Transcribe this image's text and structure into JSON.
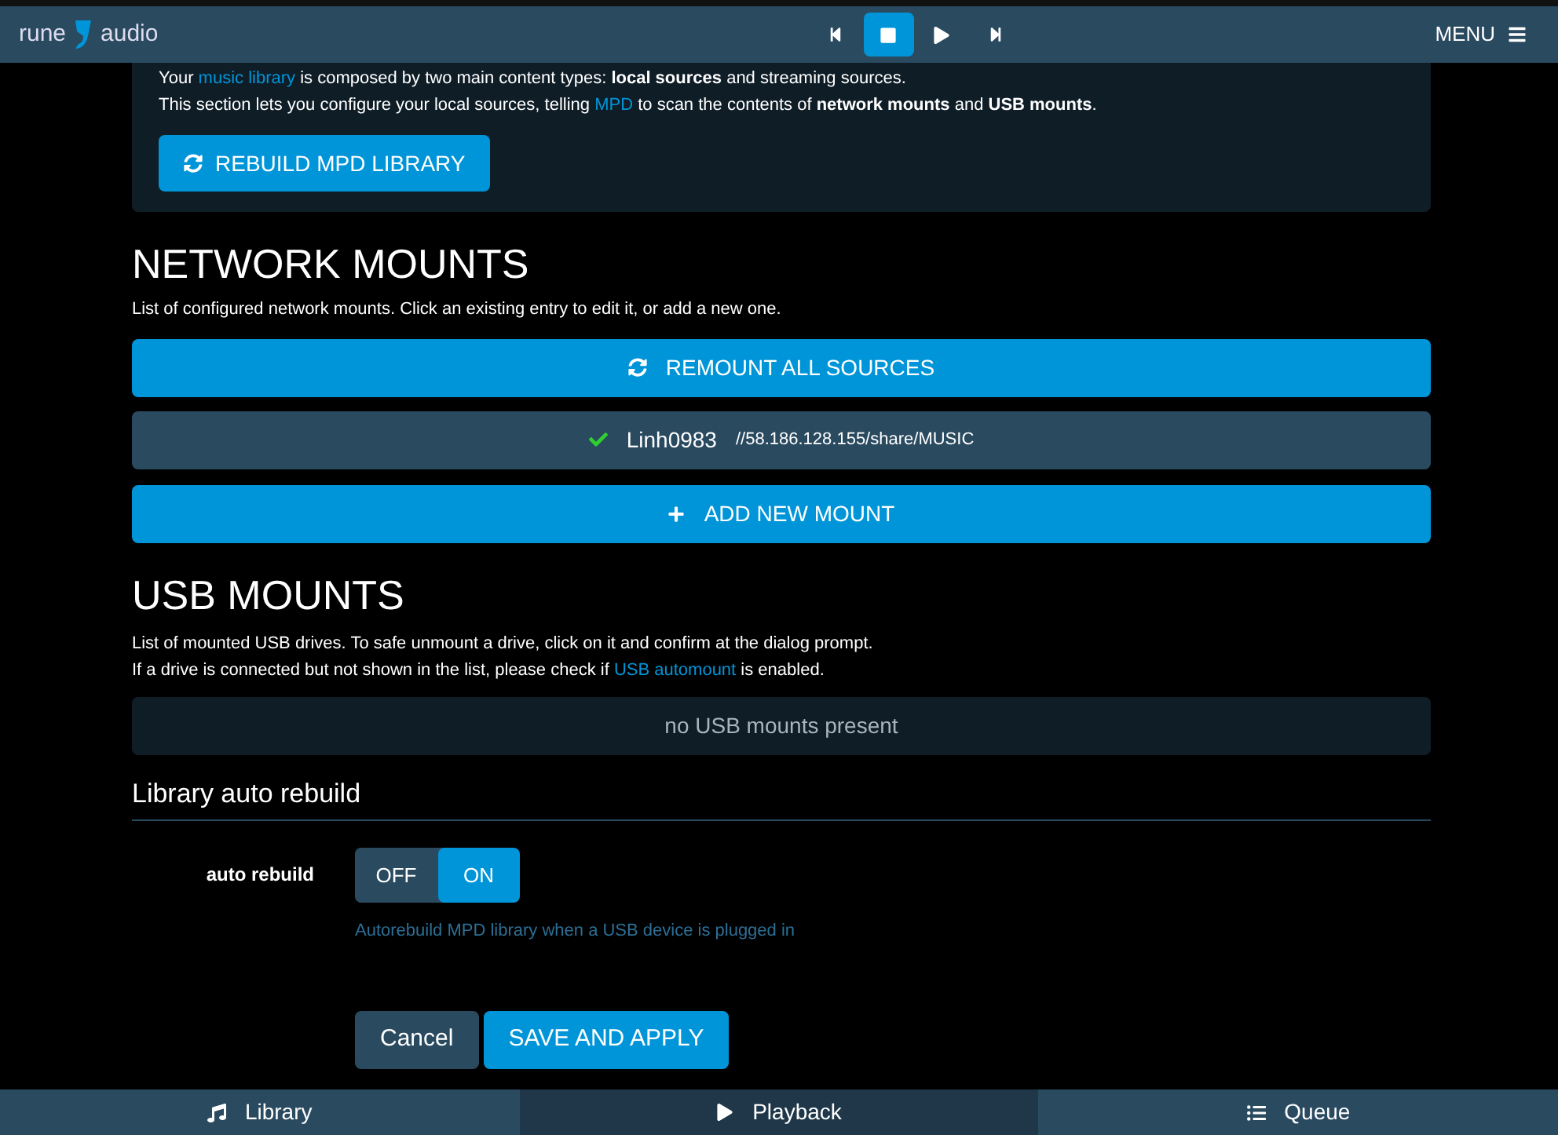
{
  "header": {
    "logo_left": "rune",
    "logo_right": "audio",
    "transport": [
      {
        "kind": "prev",
        "selected": false
      },
      {
        "kind": "stop",
        "selected": true
      },
      {
        "kind": "play",
        "selected": false
      },
      {
        "kind": "next",
        "selected": false
      }
    ],
    "menu": "MENU"
  },
  "intro": {
    "lines": [
      [
        {
          "text": "Your ",
          "kind": "text"
        },
        {
          "text": "music library",
          "kind": "link"
        },
        {
          "text": " is composed by two main content types: **local sources** and streaming sources.",
          "kind": "text"
        }
      ],
      [
        {
          "text": "This section lets you configure your local sources, telling ",
          "kind": "text"
        },
        {
          "text": "MPD",
          "kind": "link"
        },
        {
          "text": " to scan the contents of **network mounts** and **USB mounts**.",
          "kind": "text"
        }
      ]
    ],
    "button": "REBUILD MPD LIBRARY"
  },
  "network_mounts": {
    "title": "NETWORK MOUNTS",
    "description": "List of configured network mounts. Click an existing entry to edit it, or add a new one.",
    "remount_button": "REMOUNT ALL SOURCES",
    "mounts": [
      {
        "name": "Linh0983",
        "path": "//58.186.128.155/share/MUSIC",
        "mounted": true
      }
    ],
    "add_button": "ADD NEW MOUNT"
  },
  "usb_mounts": {
    "title": "USB MOUNTS",
    "lines": [
      [
        {
          "text": "List of mounted USB drives. To safe unmount a drive, click on it and confirm at the dialog prompt.",
          "kind": "text"
        }
      ],
      [
        {
          "text": "If a drive is connected but not shown in the list, please check if ",
          "kind": "text"
        },
        {
          "text": "USB automount",
          "kind": "link"
        },
        {
          "text": " is enabled.",
          "kind": "text"
        }
      ]
    ],
    "empty": "no USB mounts present"
  },
  "auto_rebuild": {
    "title": "Library auto rebuild",
    "label": "auto rebuild",
    "options": [
      {
        "label": "OFF",
        "selected": false
      },
      {
        "label": "ON",
        "selected": true
      }
    ],
    "help": "Autorebuild MPD library when a USB device is plugged in"
  },
  "actions": {
    "cancel": "Cancel",
    "save": "SAVE AND APPLY"
  },
  "tabs": [
    {
      "label": "Library",
      "selected": false
    },
    {
      "label": "Playback",
      "selected": true
    },
    {
      "label": "Queue",
      "selected": false
    }
  ]
}
